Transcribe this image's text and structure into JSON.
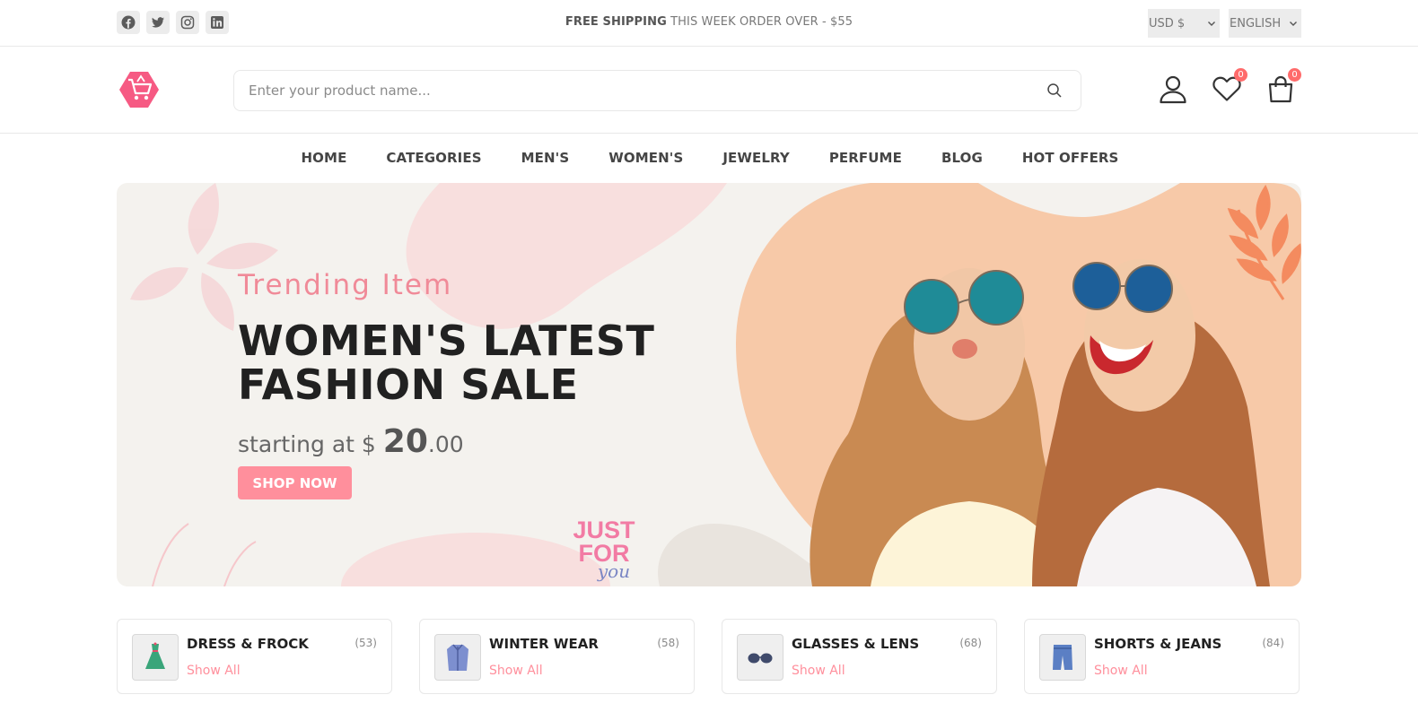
{
  "topbar": {
    "socials": [
      {
        "icon": "facebook-icon"
      },
      {
        "icon": "twitter-icon"
      },
      {
        "icon": "instagram-icon"
      },
      {
        "icon": "linkedin-icon"
      }
    ],
    "promo_bold": "FREE SHIPPING",
    "promo_rest": " THIS WEEK ORDER OVER - $55",
    "currency": "USD $",
    "language": "ENGLISH"
  },
  "header": {
    "search_placeholder": "Enter your product name...",
    "wishlist_count": "0",
    "cart_count": "0"
  },
  "nav": {
    "items": [
      "HOME",
      "CATEGORIES",
      "MEN'S",
      "WOMEN'S",
      "JEWELRY",
      "PERFUME",
      "BLOG",
      "HOT OFFERS"
    ]
  },
  "hero": {
    "subtitle": "Trending Item",
    "title_line1": "WOMEN'S LATEST",
    "title_line2": "FASHION SALE",
    "price_prefix": "starting at $ ",
    "price_whole": "20",
    "price_cents": ".00",
    "button": "SHOP NOW",
    "stamp_line1": "JUST",
    "stamp_line2": "FOR",
    "stamp_line3": "you"
  },
  "categories": [
    {
      "name": "DRESS & FROCK",
      "count": "(53)",
      "link": "Show All",
      "icon": "dress-icon"
    },
    {
      "name": "WINTER WEAR",
      "count": "(58)",
      "link": "Show All",
      "icon": "coat-icon"
    },
    {
      "name": "GLASSES & LENS",
      "count": "(68)",
      "link": "Show All",
      "icon": "glasses-icon"
    },
    {
      "name": "SHORTS & JEANS",
      "count": "(84)",
      "link": "Show All",
      "icon": "jeans-icon"
    }
  ],
  "colors": {
    "accent": "#ff8f9c",
    "hero_bg": "#f4f2ee",
    "hero_peach": "#f7c9a8",
    "text_dark": "#212121"
  }
}
